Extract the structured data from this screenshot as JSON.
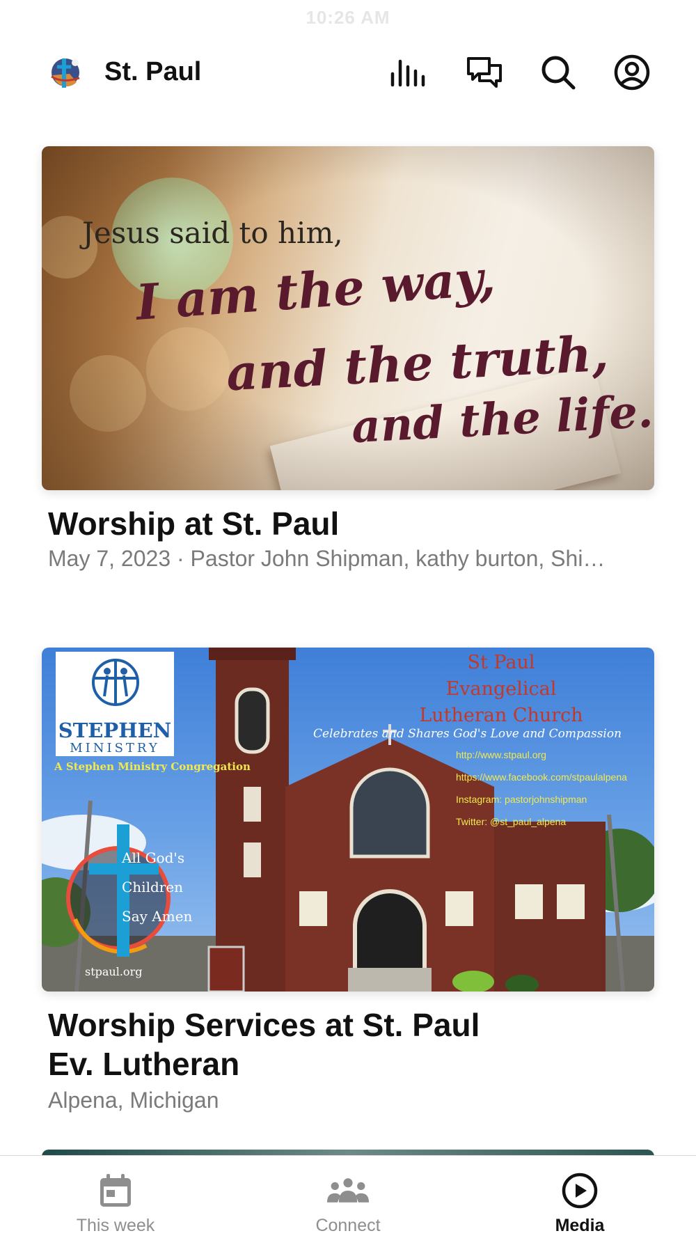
{
  "status_bar": {
    "time": "10:26 AM"
  },
  "header": {
    "title": "St. Paul",
    "icons": [
      "audio-bars-icon",
      "chat-bubbles-icon",
      "search-icon",
      "profile-icon"
    ]
  },
  "cards": [
    {
      "image": {
        "line1": "Jesus said to him,",
        "line2": "I am the way,",
        "line3": "and the truth,",
        "line4": "and the life."
      },
      "title": "Worship at St. Paul",
      "subtitle": "May 7, 2023 · Pastor John Shipman, kathy burton, Shi…"
    },
    {
      "image": {
        "ministry_name_1": "STEPHEN",
        "ministry_name_2": "MINISTRY",
        "ministry_tagline": "A Stephen Ministry Congregation",
        "church_line1": "St Paul",
        "church_line2": "Evangelical",
        "church_line3": "Lutheran Church",
        "church_motto": "Celebrates and Shares God's Love and Compassion",
        "links": [
          "http://www.stpaul.org",
          "https://www.facebook.com/stpaulalpena",
          "Instagram: pastorjohnshipman",
          "Twitter: @st_paul_alpena"
        ],
        "badge_line1": "All God's",
        "badge_line2": "Children",
        "badge_line3": "Say Amen",
        "badge_site": "stpaul.org"
      },
      "title_line1": "Worship Services at St. Paul",
      "title_line2": "Ev. Lutheran",
      "subtitle": "Alpena, Michigan"
    }
  ],
  "tabbar": {
    "tabs": [
      {
        "label": "This week",
        "icon": "calendar-icon",
        "active": false
      },
      {
        "label": "Connect",
        "icon": "people-group-icon",
        "active": false
      },
      {
        "label": "Media",
        "icon": "play-circle-icon",
        "active": true
      }
    ]
  },
  "colors": {
    "text_primary": "#111111",
    "text_secondary": "#7a7a7a",
    "tab_inactive": "#8e8e8e",
    "script_maroon": "#5a1a2e",
    "link_yellow": "#f2e94e",
    "title_red": "#c0392b"
  }
}
